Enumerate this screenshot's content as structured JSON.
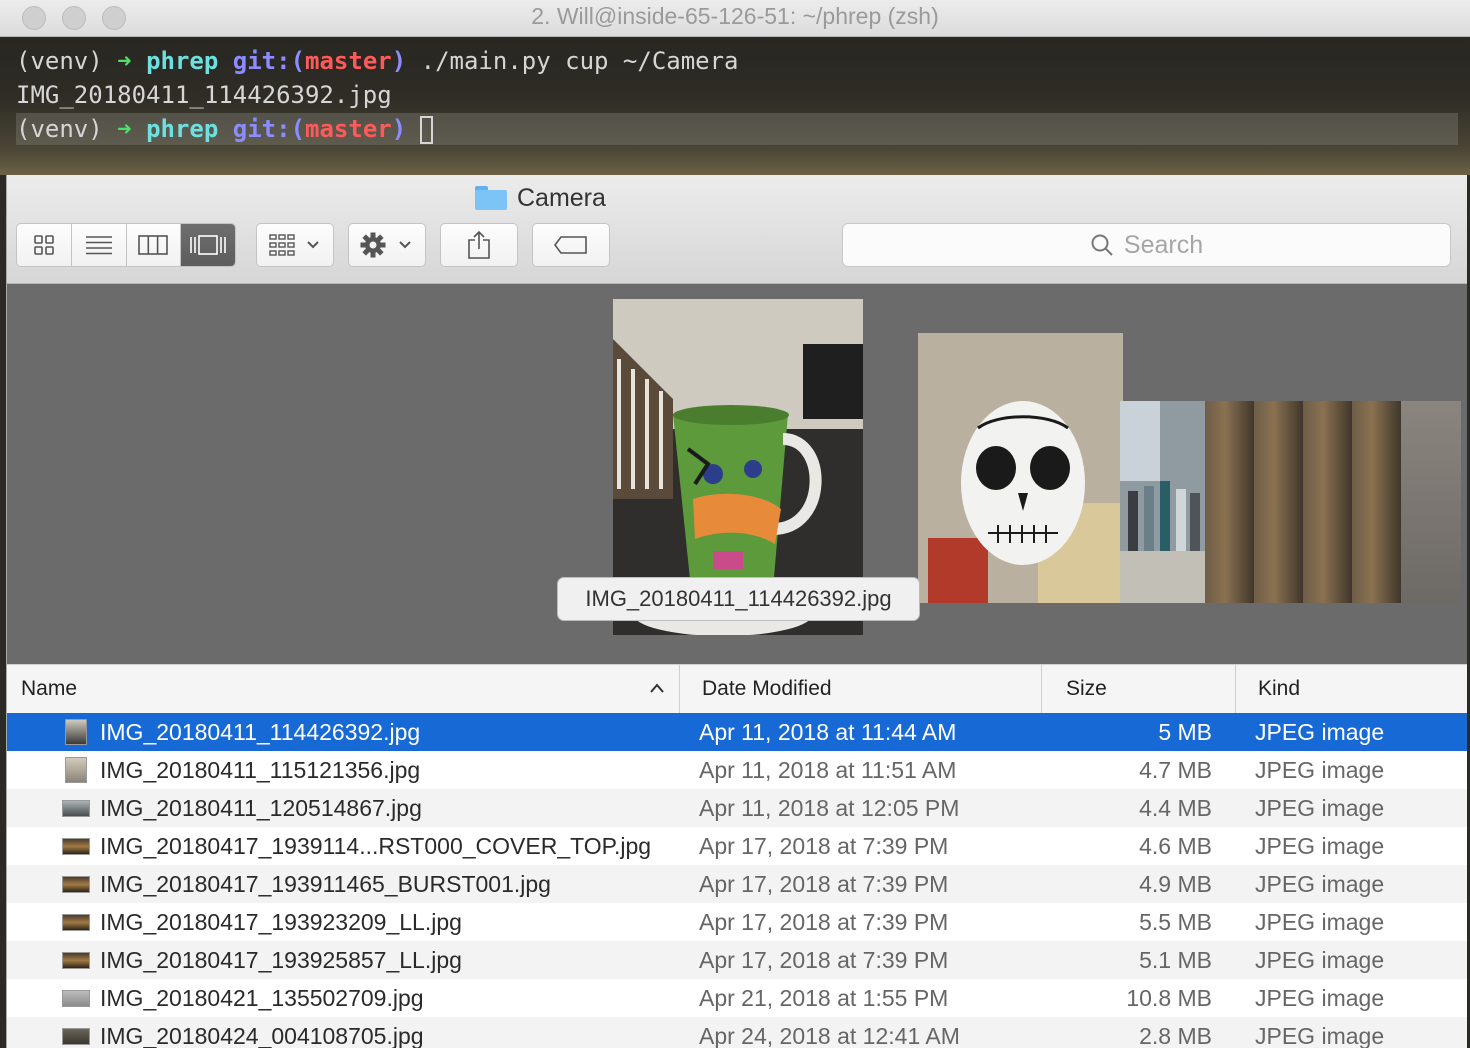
{
  "terminal": {
    "title": "2. Will@inside-65-126-51: ~/phrep (zsh)",
    "lines": [
      {
        "venv": "(venv)",
        "arrow": "➜",
        "dir": "phrep",
        "git": "git:(",
        "branch": "master",
        "git_close": ")",
        "command": "./main.py cup ~/Camera"
      },
      {
        "output": "IMG_20180411_114426392.jpg"
      },
      {
        "venv": "(venv)",
        "arrow": "➜",
        "dir": "phrep",
        "git": "git:(",
        "branch": "master",
        "git_close": ")",
        "command": ""
      }
    ]
  },
  "finder": {
    "title": "Camera",
    "toolbar": {
      "view_modes": [
        "icon-view",
        "list-view",
        "column-view",
        "cover-flow-view"
      ],
      "active_view": "cover-flow-view",
      "arrange_icon": "arrange-icon",
      "action_icon": "gear-icon",
      "share_icon": "share-icon",
      "tags_icon": "tag-icon",
      "search_placeholder": "Search"
    },
    "coverflow": {
      "caption": "IMG_20180411_114426392.jpg"
    },
    "columns": {
      "name": "Name",
      "date": "Date Modified",
      "size": "Size",
      "kind": "Kind",
      "sort_indicator": "⌃"
    },
    "files": [
      {
        "name": "IMG_20180411_114426392.jpg",
        "date": "Apr 11, 2018 at 11:44 AM",
        "size": "5 MB",
        "kind": "JPEG image",
        "selected": true
      },
      {
        "name": "IMG_20180411_115121356.jpg",
        "date": "Apr 11, 2018 at 11:51 AM",
        "size": "4.7 MB",
        "kind": "JPEG image"
      },
      {
        "name": "IMG_20180411_120514867.jpg",
        "date": "Apr 11, 2018 at 12:05 PM",
        "size": "4.4 MB",
        "kind": "JPEG image"
      },
      {
        "name": "IMG_20180417_1939114...RST000_COVER_TOP.jpg",
        "date": "Apr 17, 2018 at 7:39 PM",
        "size": "4.6 MB",
        "kind": "JPEG image"
      },
      {
        "name": "IMG_20180417_193911465_BURST001.jpg",
        "date": "Apr 17, 2018 at 7:39 PM",
        "size": "4.9 MB",
        "kind": "JPEG image"
      },
      {
        "name": "IMG_20180417_193923209_LL.jpg",
        "date": "Apr 17, 2018 at 7:39 PM",
        "size": "5.5 MB",
        "kind": "JPEG image"
      },
      {
        "name": "IMG_20180417_193925857_LL.jpg",
        "date": "Apr 17, 2018 at 7:39 PM",
        "size": "5.1 MB",
        "kind": "JPEG image"
      },
      {
        "name": "IMG_20180421_135502709.jpg",
        "date": "Apr 21, 2018 at 1:55 PM",
        "size": "10.8 MB",
        "kind": "JPEG image"
      },
      {
        "name": "IMG_20180424_004108705.jpg",
        "date": "Apr 24, 2018 at 12:41 AM",
        "size": "2.8 MB",
        "kind": "JPEG image"
      }
    ],
    "colors": {
      "selection": "#1769d6",
      "folder": "#7cc4f6"
    }
  }
}
